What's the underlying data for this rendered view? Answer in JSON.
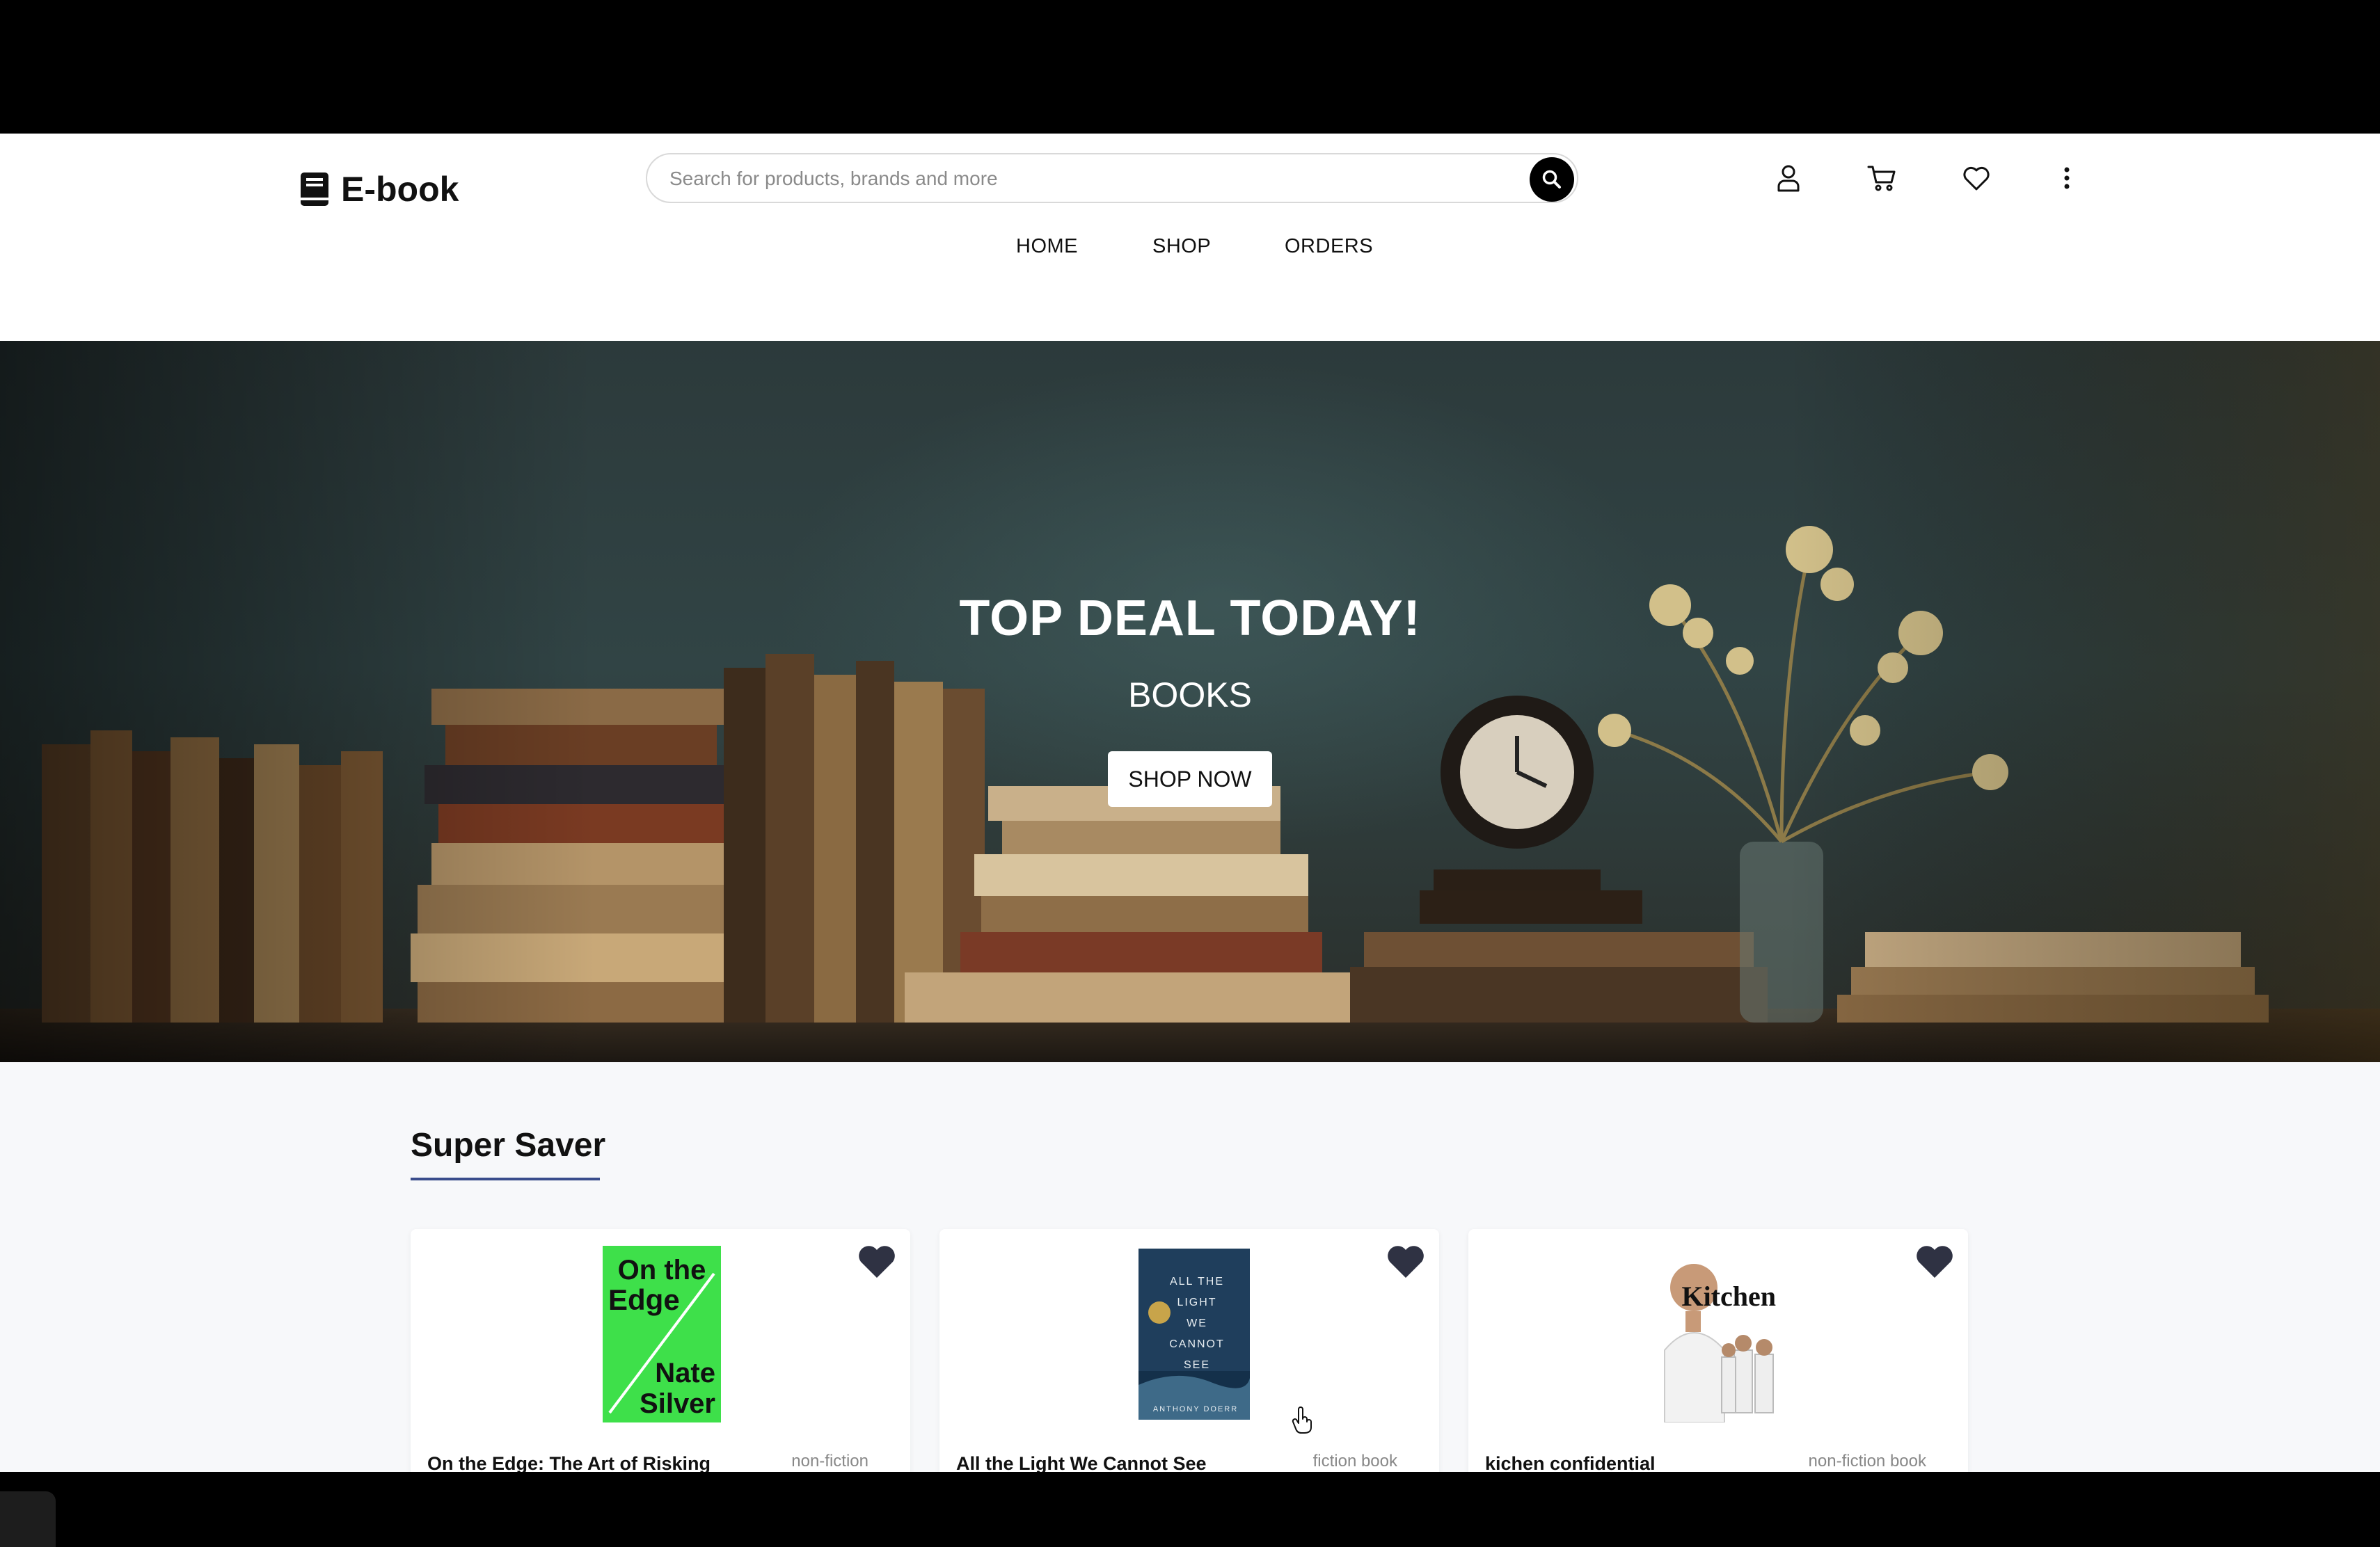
{
  "brand": {
    "name": "E-book"
  },
  "search": {
    "placeholder": "Search for products, brands and more"
  },
  "header_icons": [
    "user-icon",
    "cart-icon",
    "heart-icon",
    "more-vertical-icon"
  ],
  "nav": {
    "items": [
      "HOME",
      "SHOP",
      "ORDERS"
    ]
  },
  "hero": {
    "title": "TOP DEAL TODAY!",
    "subtitle": "BOOKS",
    "cta": "SHOP NOW"
  },
  "section": {
    "title": "Super Saver",
    "accent": "#3a4d8c"
  },
  "products": [
    {
      "title": "On the Edge: The Art of Risking",
      "category": "non-fiction",
      "cover_text": [
        "On the",
        "Edge",
        "Nate",
        "Silver"
      ],
      "cover_color": "#3ee04a"
    },
    {
      "title": "All the Light We Cannot See",
      "category": "fiction book",
      "cover_text": [
        "ALL THE",
        "LIGHT",
        "WE",
        "CANNOT",
        "SEE",
        "ANTHONY DOERR"
      ],
      "cover_color": "#1f3e5c"
    },
    {
      "title": "kichen confidential",
      "category": "non-fiction book",
      "cover_text": [
        "Kitchen"
      ],
      "cover_color": "#ffffff"
    }
  ]
}
